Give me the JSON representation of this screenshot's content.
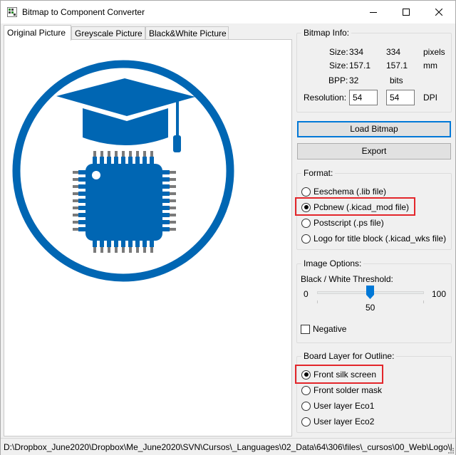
{
  "window": {
    "title": "Bitmap to Component Converter",
    "minimize_icon": "minimize-icon",
    "maximize_icon": "maximize-icon",
    "close_icon": "close-icon"
  },
  "tabs": [
    {
      "label": "Original Picture",
      "active": true
    },
    {
      "label": "Greyscale Picture",
      "active": false
    },
    {
      "label": "Black&White Picture",
      "active": false
    }
  ],
  "picture": {
    "icon": "graduation-cap-chip-logo",
    "color": "#0066b3"
  },
  "bitmap_info": {
    "title": "Bitmap Info:",
    "size_label": "Size:",
    "width_px": "334",
    "height_px": "334",
    "unit_px": "pixels",
    "width_mm": "157.1",
    "height_mm": "157.1",
    "unit_mm": "mm",
    "bpp_label": "BPP:",
    "bpp_value": "32",
    "bpp_unit": "bits",
    "resolution_label": "Resolution:",
    "res_x": "54",
    "res_y": "54",
    "res_unit": "DPI"
  },
  "buttons": {
    "load": "Load Bitmap",
    "export": "Export"
  },
  "format": {
    "title": "Format:",
    "options": [
      {
        "label": "Eeschema (.lib file)",
        "checked": false
      },
      {
        "label": "Pcbnew (.kicad_mod file)",
        "checked": true
      },
      {
        "label": "Postscript (.ps file)",
        "checked": false
      },
      {
        "label": "Logo for title block (.kicad_wks file)",
        "checked": false
      }
    ]
  },
  "image_options": {
    "title": "Image Options:",
    "threshold_label": "Black / White Threshold:",
    "min": "0",
    "max": "100",
    "value": "50",
    "negative_label": "Negative",
    "negative_checked": false
  },
  "board_layer": {
    "title": "Board Layer for Outline:",
    "options": [
      {
        "label": "Front silk screen",
        "checked": true
      },
      {
        "label": "Front solder mask",
        "checked": false
      },
      {
        "label": "User layer Eco1",
        "checked": false
      },
      {
        "label": "User layer Eco2",
        "checked": false
      }
    ]
  },
  "status": {
    "path": "D:\\Dropbox_June2020\\Dropbox\\Me_June2020\\SVN\\Cursos\\_Languages\\02_Data\\64\\306\\files\\_cursos\\00_Web\\Logo\\l"
  },
  "colors": {
    "accent": "#0078d7",
    "highlight": "#e3262b",
    "logo_blue": "#0066b3"
  }
}
